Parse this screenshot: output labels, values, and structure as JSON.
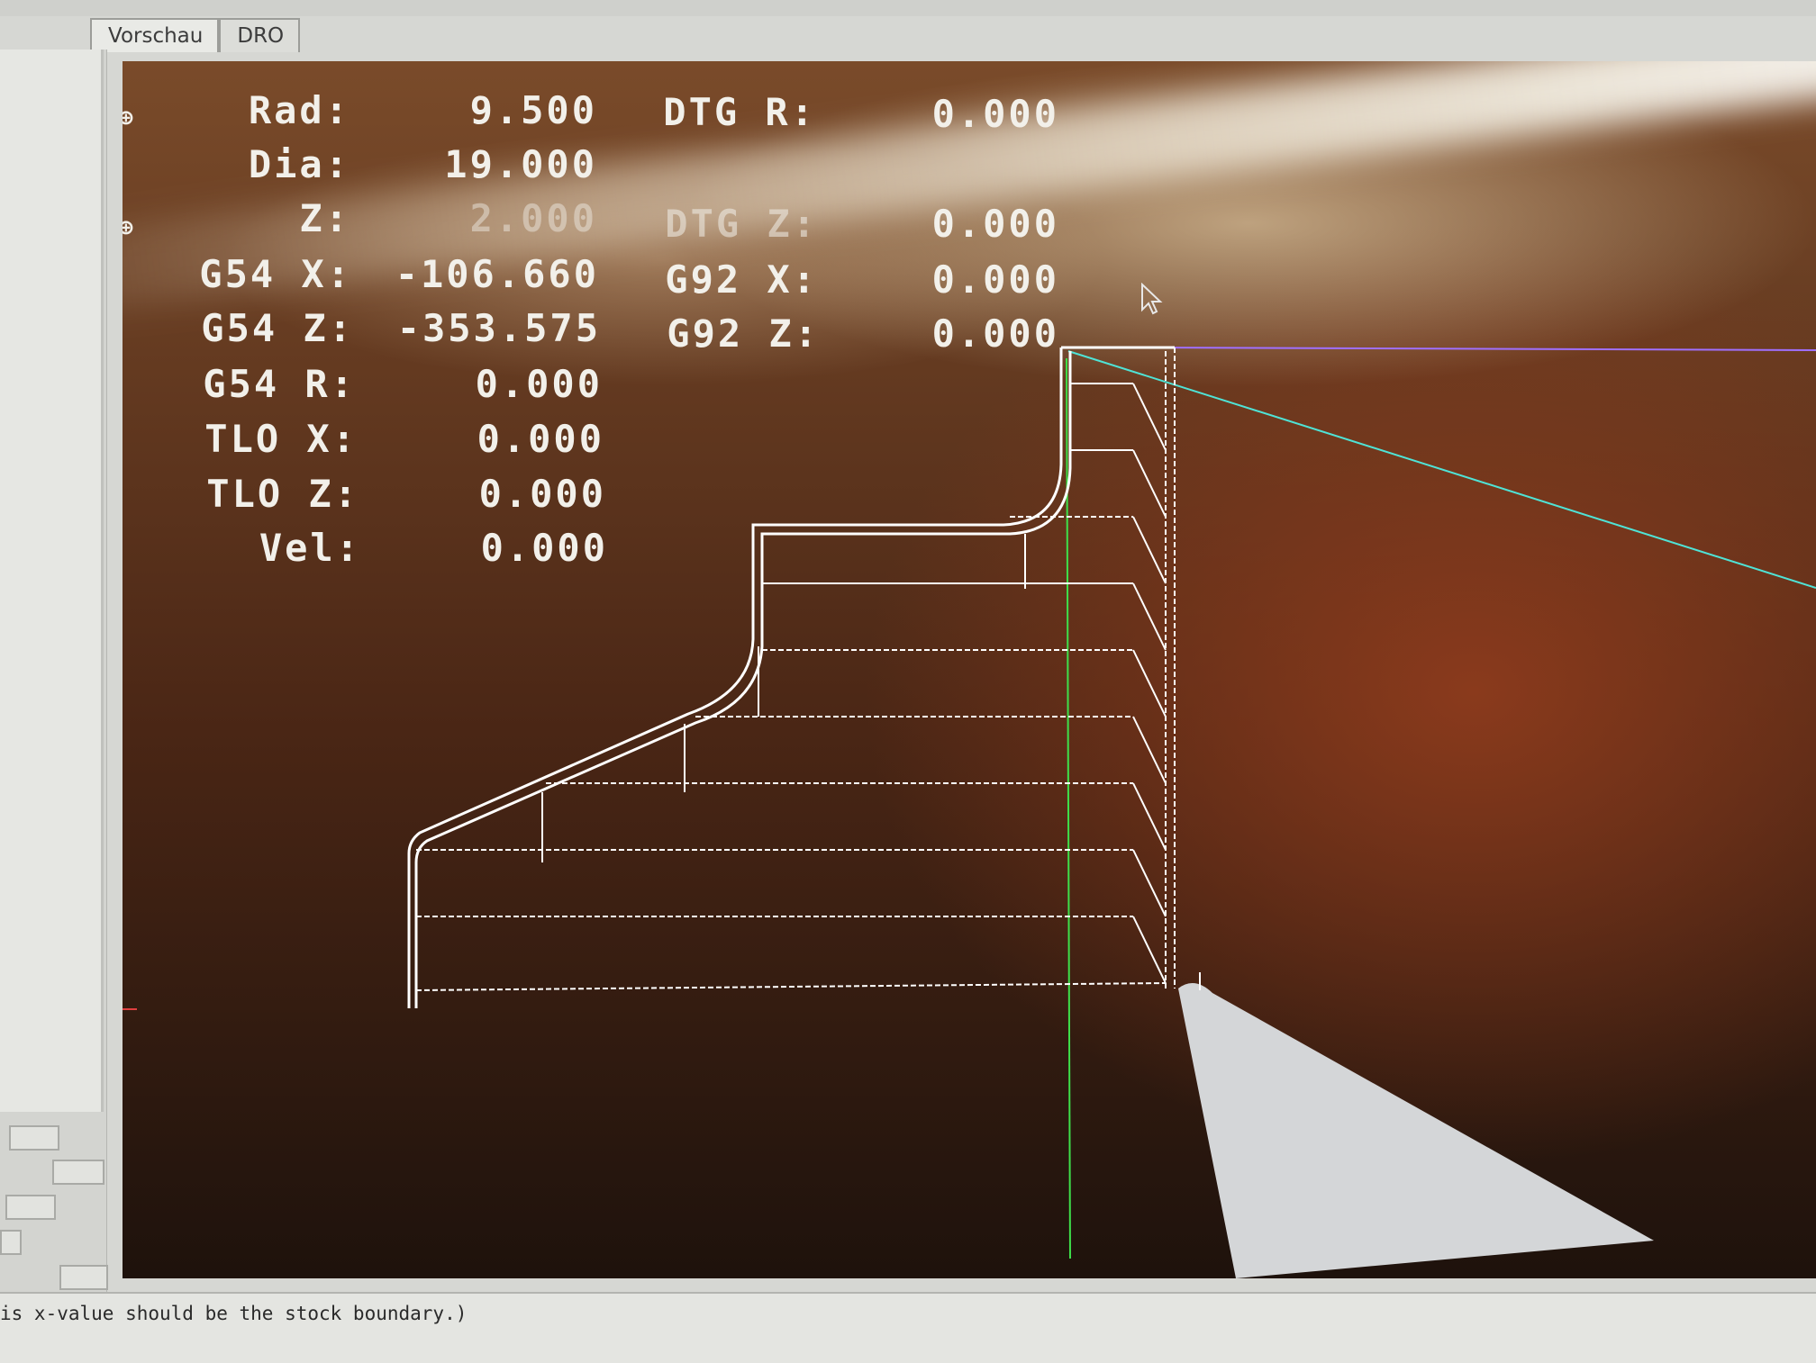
{
  "tabs": [
    {
      "label": "Vorschau",
      "active": true
    },
    {
      "label": "DRO",
      "active": false
    }
  ],
  "dro": {
    "left": [
      {
        "label": "Rad:",
        "value": "9.500",
        "homed_icon": "crosshair-homed-icon"
      },
      {
        "label": "Dia:",
        "value": "19.000"
      },
      {
        "label": "Z:",
        "value": "2.000",
        "homed_icon": "crosshair-homed-icon"
      },
      {
        "label": "G54 X:",
        "value": "-106.660"
      },
      {
        "label": "G54 Z:",
        "value": "-353.575"
      },
      {
        "label": "G54 R:",
        "value": "0.000"
      },
      {
        "label": "TLO X:",
        "value": "0.000"
      },
      {
        "label": "TLO Z:",
        "value": "0.000"
      },
      {
        "label": "Vel:",
        "value": "0.000"
      }
    ],
    "right": [
      {
        "label": "DTG R:",
        "value": "0.000"
      },
      {
        "label": "DTG Z:",
        "value": "0.000"
      },
      {
        "label": "G92 X:",
        "value": "0.000"
      },
      {
        "label": "G92 Z:",
        "value": "0.000"
      }
    ]
  },
  "colors": {
    "toolpath": "#ffffff",
    "rapid_move": "#4fe3d6",
    "z_axis_line": "#3ee04a",
    "limit_line": "#a070ff",
    "tool": "#d4d6d8"
  },
  "console": {
    "line": "is x-value should be the stock boundary.)"
  }
}
